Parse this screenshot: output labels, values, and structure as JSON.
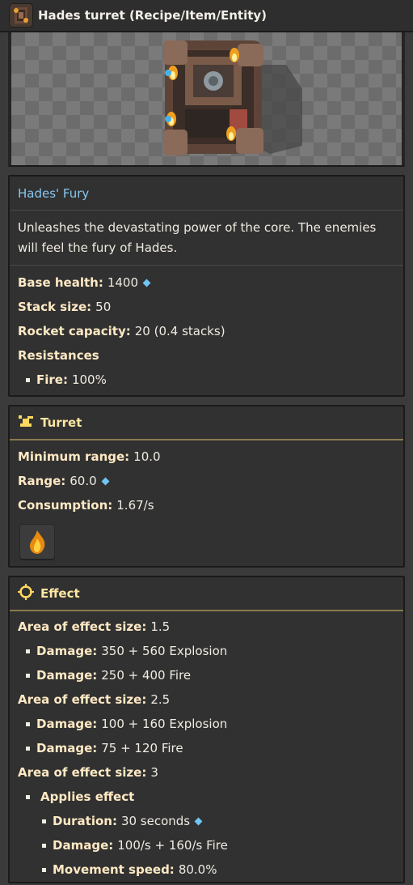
{
  "header": {
    "title": "Hades turret (Recipe/Item/Entity)",
    "icon": "hades-turret-icon"
  },
  "item": {
    "name": "Hades' Fury",
    "description": "Unleashes the devastating power of the core. The enemies will feel the fury of Hades.",
    "stats": [
      {
        "label": "Base health:",
        "value": "1400"
      },
      {
        "label": "Stack size:",
        "value": "50"
      },
      {
        "label": "Rocket capacity:",
        "value": "20 (0.4 stacks)"
      }
    ],
    "resistances_label": "Resistances",
    "resistances": [
      {
        "label": "Fire:",
        "value": "100%"
      }
    ]
  },
  "turret": {
    "title": "Turret",
    "icon": "turret-icon",
    "stats": [
      {
        "label": "Minimum range:",
        "value": "10.0"
      },
      {
        "label": "Range:",
        "value": "60.0"
      },
      {
        "label": "Consumption:",
        "value": "1.67/s"
      }
    ],
    "ammo_icon": "flame-icon"
  },
  "effect": {
    "title": "Effect",
    "icon": "crosshair-icon",
    "groups": [
      {
        "label": "Area of effect size:",
        "value": "1.5",
        "damage": [
          {
            "label": "Damage:",
            "value": "350 + 560 Explosion"
          },
          {
            "label": "Damage:",
            "value": "250 + 400 Fire"
          }
        ]
      },
      {
        "label": "Area of effect size:",
        "value": "2.5",
        "damage": [
          {
            "label": "Damage:",
            "value": "100 + 160 Explosion"
          },
          {
            "label": "Damage:",
            "value": "75 + 120 Fire"
          }
        ]
      },
      {
        "label": "Area of effect size:",
        "value": "3"
      }
    ],
    "applies_label": "Applies effect",
    "applied": [
      {
        "label": "Duration:",
        "value": "30 seconds"
      },
      {
        "label": "Damage:",
        "value": "100/s + 160/s Fire"
      },
      {
        "label": "Movement speed:",
        "value": "80.0%"
      }
    ]
  },
  "colors": {
    "accent_gold": "#ffe6a0",
    "link_blue": "#86c8f0",
    "diamond": "#6fc6f2"
  }
}
